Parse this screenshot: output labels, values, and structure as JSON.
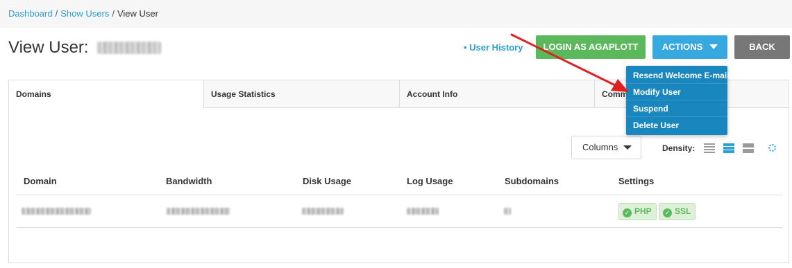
{
  "breadcrumb": {
    "items": [
      {
        "label": "Dashboard"
      },
      {
        "label": "Show Users"
      },
      {
        "label": "View User"
      }
    ],
    "separator": "/"
  },
  "header": {
    "title": "View User:",
    "user_history_label": "• User History"
  },
  "buttons": {
    "login_label": "LOGIN AS AGAPLOTT",
    "actions_label": "ACTIONS",
    "back_label": "BACK"
  },
  "actions_menu": {
    "items": [
      {
        "label": "Resend Welcome E-mail"
      },
      {
        "label": "Modify User"
      },
      {
        "label": "Suspend"
      },
      {
        "label": "Delete User"
      }
    ]
  },
  "tabs": [
    {
      "label": "Domains",
      "active": true
    },
    {
      "label": "Usage Statistics",
      "active": false
    },
    {
      "label": "Account Info",
      "active": false
    },
    {
      "label": "Comm",
      "active": false
    }
  ],
  "toolbar": {
    "columns_label": "Columns",
    "density_label": "Density:",
    "density_selected": "standard"
  },
  "table": {
    "columns": [
      "Domain",
      "Bandwidth",
      "Disk Usage",
      "Log Usage",
      "Subdomains",
      "Settings"
    ],
    "rows": [
      {
        "settings": [
          {
            "label": "PHP"
          },
          {
            "label": "SSL"
          }
        ]
      }
    ]
  },
  "colors": {
    "link": "#2a9fd6",
    "login_button": "#5cb85c",
    "actions_button": "#38a9e0",
    "back_button": "#777777",
    "dropdown": "#1a86be",
    "arrow": "#e02020"
  },
  "icons": [
    "caret-down-icon",
    "density-compact-icon",
    "density-standard-icon",
    "density-comfortable-icon",
    "refresh-icon",
    "check-circle-icon"
  ]
}
